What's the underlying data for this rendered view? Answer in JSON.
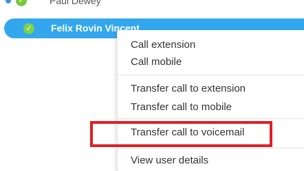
{
  "contacts": [
    {
      "name": "Paul Dewey",
      "status": "available"
    },
    {
      "name": "Felix Rovin Vincent",
      "status": "available",
      "selected": true
    }
  ],
  "context_menu": {
    "call_extension": "Call extension",
    "call_mobile": "Call mobile",
    "transfer_extension": "Transfer call to extension",
    "transfer_mobile": "Transfer call to mobile",
    "transfer_voicemail": "Transfer call to voicemail",
    "view_user_details": "View user details"
  },
  "colors": {
    "selection": "#33a7ee",
    "available": "#78c93c",
    "highlight": "#e01e24"
  }
}
